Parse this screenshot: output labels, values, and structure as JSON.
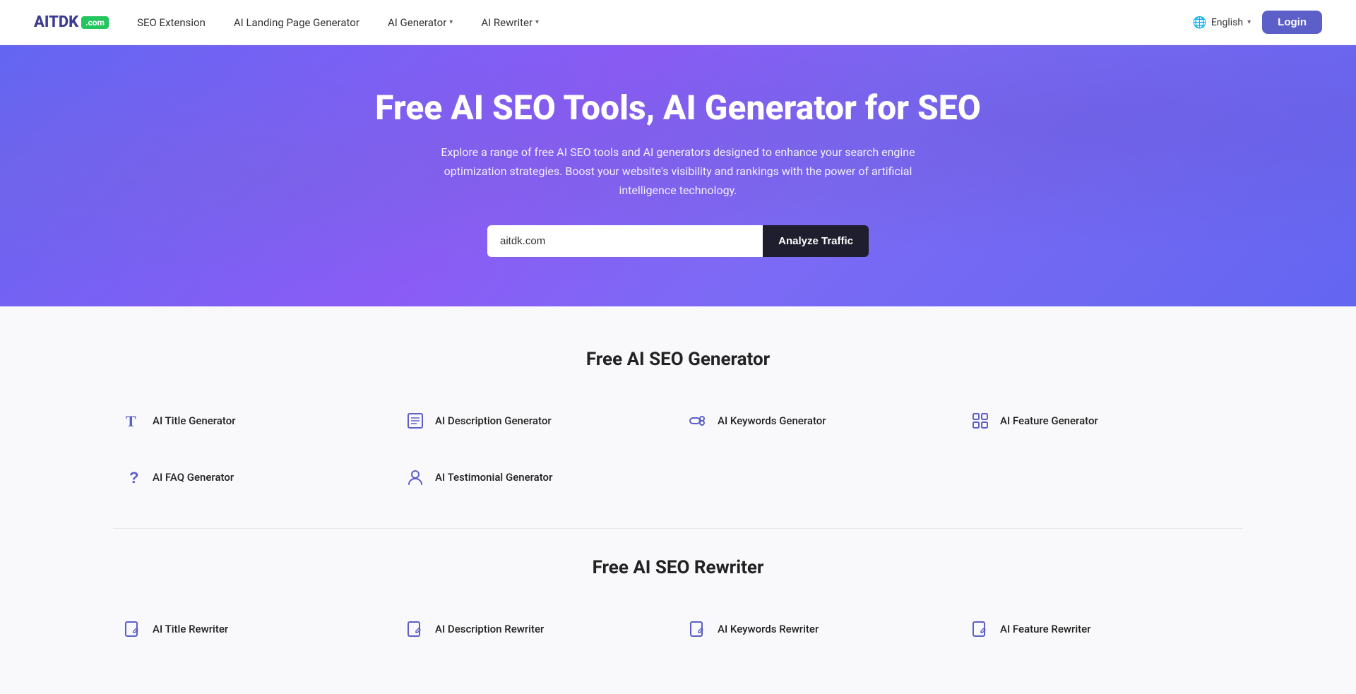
{
  "brand": {
    "name": "AITDK",
    "badge": ".com"
  },
  "nav": {
    "links": [
      {
        "label": "SEO Extension",
        "hasDropdown": false
      },
      {
        "label": "AI Landing Page Generator",
        "hasDropdown": false
      },
      {
        "label": "AI Generator",
        "hasDropdown": true
      },
      {
        "label": "AI Rewriter",
        "hasDropdown": true
      }
    ],
    "language": "English",
    "loginLabel": "Login"
  },
  "hero": {
    "title": "Free AI SEO Tools, AI Generator for SEO",
    "subtitle": "Explore a range of free AI SEO tools and AI generators designed to enhance your search engine optimization strategies. Boost your website's visibility and rankings with the power of artificial intelligence technology.",
    "inputValue": "aitdk.com",
    "inputPlaceholder": "aitdk.com",
    "buttonLabel": "Analyze Traffic"
  },
  "generator_section": {
    "title": "Free AI SEO Generator",
    "tools": [
      {
        "label": "AI Title Generator",
        "icon": "title"
      },
      {
        "label": "AI Description Generator",
        "icon": "description"
      },
      {
        "label": "AI Keywords Generator",
        "icon": "keywords"
      },
      {
        "label": "AI Feature Generator",
        "icon": "feature"
      },
      {
        "label": "AI FAQ Generator",
        "icon": "faq"
      },
      {
        "label": "AI Testimonial Generator",
        "icon": "testimonial"
      }
    ]
  },
  "rewriter_section": {
    "title": "Free AI SEO Rewriter",
    "tools": [
      {
        "label": "AI Title Rewriter",
        "icon": "edit"
      },
      {
        "label": "AI Description Rewriter",
        "icon": "edit"
      },
      {
        "label": "AI Keywords Rewriter",
        "icon": "edit"
      },
      {
        "label": "AI Feature Rewriter",
        "icon": "edit"
      }
    ]
  }
}
